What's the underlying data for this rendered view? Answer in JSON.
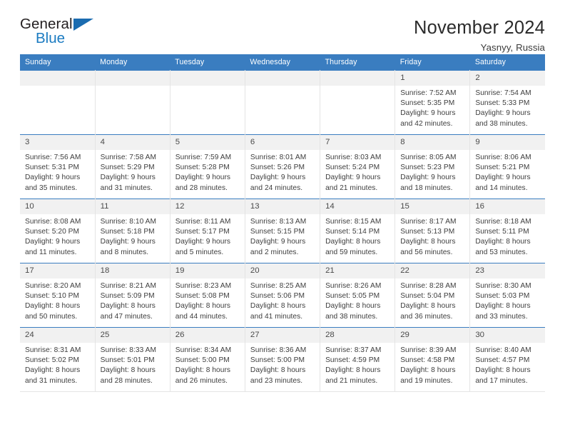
{
  "brand": {
    "name_part1": "General",
    "name_part2": "Blue",
    "accent_color": "#1b7bc1",
    "triangle_color": "#1b6cb0",
    "triangle_icon": "triangle-icon"
  },
  "header": {
    "title": "November 2024",
    "location": "Yasnyy, Russia"
  },
  "calendar": {
    "header_bg": "#3a7dc0",
    "daynum_bg": "#f1f1f1",
    "weekday_headers": [
      "Sunday",
      "Monday",
      "Tuesday",
      "Wednesday",
      "Thursday",
      "Friday",
      "Saturday"
    ],
    "labels": {
      "sunrise": "Sunrise:",
      "sunset": "Sunset:",
      "daylight": "Daylight:"
    },
    "weeks": [
      [
        {
          "day": "",
          "sunrise": "",
          "sunset": "",
          "daylight": ""
        },
        {
          "day": "",
          "sunrise": "",
          "sunset": "",
          "daylight": ""
        },
        {
          "day": "",
          "sunrise": "",
          "sunset": "",
          "daylight": ""
        },
        {
          "day": "",
          "sunrise": "",
          "sunset": "",
          "daylight": ""
        },
        {
          "day": "",
          "sunrise": "",
          "sunset": "",
          "daylight": ""
        },
        {
          "day": "1",
          "sunrise": "Sunrise: 7:52 AM",
          "sunset": "Sunset: 5:35 PM",
          "daylight": "Daylight: 9 hours and 42 minutes."
        },
        {
          "day": "2",
          "sunrise": "Sunrise: 7:54 AM",
          "sunset": "Sunset: 5:33 PM",
          "daylight": "Daylight: 9 hours and 38 minutes."
        }
      ],
      [
        {
          "day": "3",
          "sunrise": "Sunrise: 7:56 AM",
          "sunset": "Sunset: 5:31 PM",
          "daylight": "Daylight: 9 hours and 35 minutes."
        },
        {
          "day": "4",
          "sunrise": "Sunrise: 7:58 AM",
          "sunset": "Sunset: 5:29 PM",
          "daylight": "Daylight: 9 hours and 31 minutes."
        },
        {
          "day": "5",
          "sunrise": "Sunrise: 7:59 AM",
          "sunset": "Sunset: 5:28 PM",
          "daylight": "Daylight: 9 hours and 28 minutes."
        },
        {
          "day": "6",
          "sunrise": "Sunrise: 8:01 AM",
          "sunset": "Sunset: 5:26 PM",
          "daylight": "Daylight: 9 hours and 24 minutes."
        },
        {
          "day": "7",
          "sunrise": "Sunrise: 8:03 AM",
          "sunset": "Sunset: 5:24 PM",
          "daylight": "Daylight: 9 hours and 21 minutes."
        },
        {
          "day": "8",
          "sunrise": "Sunrise: 8:05 AM",
          "sunset": "Sunset: 5:23 PM",
          "daylight": "Daylight: 9 hours and 18 minutes."
        },
        {
          "day": "9",
          "sunrise": "Sunrise: 8:06 AM",
          "sunset": "Sunset: 5:21 PM",
          "daylight": "Daylight: 9 hours and 14 minutes."
        }
      ],
      [
        {
          "day": "10",
          "sunrise": "Sunrise: 8:08 AM",
          "sunset": "Sunset: 5:20 PM",
          "daylight": "Daylight: 9 hours and 11 minutes."
        },
        {
          "day": "11",
          "sunrise": "Sunrise: 8:10 AM",
          "sunset": "Sunset: 5:18 PM",
          "daylight": "Daylight: 9 hours and 8 minutes."
        },
        {
          "day": "12",
          "sunrise": "Sunrise: 8:11 AM",
          "sunset": "Sunset: 5:17 PM",
          "daylight": "Daylight: 9 hours and 5 minutes."
        },
        {
          "day": "13",
          "sunrise": "Sunrise: 8:13 AM",
          "sunset": "Sunset: 5:15 PM",
          "daylight": "Daylight: 9 hours and 2 minutes."
        },
        {
          "day": "14",
          "sunrise": "Sunrise: 8:15 AM",
          "sunset": "Sunset: 5:14 PM",
          "daylight": "Daylight: 8 hours and 59 minutes."
        },
        {
          "day": "15",
          "sunrise": "Sunrise: 8:17 AM",
          "sunset": "Sunset: 5:13 PM",
          "daylight": "Daylight: 8 hours and 56 minutes."
        },
        {
          "day": "16",
          "sunrise": "Sunrise: 8:18 AM",
          "sunset": "Sunset: 5:11 PM",
          "daylight": "Daylight: 8 hours and 53 minutes."
        }
      ],
      [
        {
          "day": "17",
          "sunrise": "Sunrise: 8:20 AM",
          "sunset": "Sunset: 5:10 PM",
          "daylight": "Daylight: 8 hours and 50 minutes."
        },
        {
          "day": "18",
          "sunrise": "Sunrise: 8:21 AM",
          "sunset": "Sunset: 5:09 PM",
          "daylight": "Daylight: 8 hours and 47 minutes."
        },
        {
          "day": "19",
          "sunrise": "Sunrise: 8:23 AM",
          "sunset": "Sunset: 5:08 PM",
          "daylight": "Daylight: 8 hours and 44 minutes."
        },
        {
          "day": "20",
          "sunrise": "Sunrise: 8:25 AM",
          "sunset": "Sunset: 5:06 PM",
          "daylight": "Daylight: 8 hours and 41 minutes."
        },
        {
          "day": "21",
          "sunrise": "Sunrise: 8:26 AM",
          "sunset": "Sunset: 5:05 PM",
          "daylight": "Daylight: 8 hours and 38 minutes."
        },
        {
          "day": "22",
          "sunrise": "Sunrise: 8:28 AM",
          "sunset": "Sunset: 5:04 PM",
          "daylight": "Daylight: 8 hours and 36 minutes."
        },
        {
          "day": "23",
          "sunrise": "Sunrise: 8:30 AM",
          "sunset": "Sunset: 5:03 PM",
          "daylight": "Daylight: 8 hours and 33 minutes."
        }
      ],
      [
        {
          "day": "24",
          "sunrise": "Sunrise: 8:31 AM",
          "sunset": "Sunset: 5:02 PM",
          "daylight": "Daylight: 8 hours and 31 minutes."
        },
        {
          "day": "25",
          "sunrise": "Sunrise: 8:33 AM",
          "sunset": "Sunset: 5:01 PM",
          "daylight": "Daylight: 8 hours and 28 minutes."
        },
        {
          "day": "26",
          "sunrise": "Sunrise: 8:34 AM",
          "sunset": "Sunset: 5:00 PM",
          "daylight": "Daylight: 8 hours and 26 minutes."
        },
        {
          "day": "27",
          "sunrise": "Sunrise: 8:36 AM",
          "sunset": "Sunset: 5:00 PM",
          "daylight": "Daylight: 8 hours and 23 minutes."
        },
        {
          "day": "28",
          "sunrise": "Sunrise: 8:37 AM",
          "sunset": "Sunset: 4:59 PM",
          "daylight": "Daylight: 8 hours and 21 minutes."
        },
        {
          "day": "29",
          "sunrise": "Sunrise: 8:39 AM",
          "sunset": "Sunset: 4:58 PM",
          "daylight": "Daylight: 8 hours and 19 minutes."
        },
        {
          "day": "30",
          "sunrise": "Sunrise: 8:40 AM",
          "sunset": "Sunset: 4:57 PM",
          "daylight": "Daylight: 8 hours and 17 minutes."
        }
      ]
    ]
  }
}
